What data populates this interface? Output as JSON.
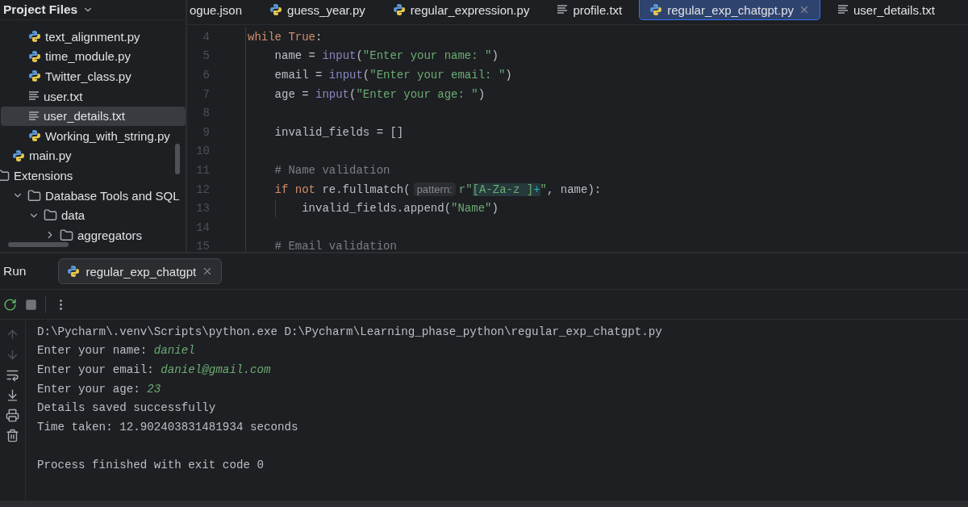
{
  "sidebar": {
    "title": "Project Files",
    "tree": [
      {
        "children": [
          {
            "children": [
              {
                "label": "text_alignment.py",
                "kind": "python",
                "selected": false
              },
              {
                "label": "time_module.py",
                "kind": "python",
                "selected": false
              },
              {
                "label": "Twitter_class.py",
                "kind": "python",
                "selected": false
              },
              {
                "label": "user.txt",
                "kind": "text",
                "selected": false
              },
              {
                "label": "user_details.txt",
                "kind": "text",
                "selected": true
              },
              {
                "label": "Working_with_string.py",
                "kind": "python",
                "selected": false
              }
            ]
          },
          {
            "label": "main.py",
            "kind": "python",
            "selected": false
          }
        ]
      },
      {
        "label": "Extensions",
        "kind": "folder",
        "selected": false,
        "children": [
          {
            "label": "Database Tools and SQL",
            "kind": "folder",
            "selected": false,
            "expanded": true,
            "children": [
              {
                "label": "data",
                "kind": "folder",
                "selected": false,
                "expanded": true,
                "children": [
                  {
                    "label": "aggregators",
                    "kind": "folder",
                    "selected": false,
                    "expanded": false
                  }
                ]
              }
            ]
          }
        ]
      }
    ]
  },
  "editor": {
    "tabs": [
      {
        "label": "ogue.json",
        "kind": "json",
        "selected": false,
        "closable": false
      },
      {
        "label": "guess_year.py",
        "kind": "python",
        "selected": false,
        "closable": false
      },
      {
        "label": "regular_expression.py",
        "kind": "python",
        "selected": false,
        "closable": false
      },
      {
        "label": "profile.txt",
        "kind": "text",
        "selected": false,
        "closable": false
      },
      {
        "label": "regular_exp_chatgpt.py",
        "kind": "python",
        "selected": true,
        "closable": true
      },
      {
        "label": "user_details.txt",
        "kind": "text",
        "selected": false,
        "closable": false
      }
    ],
    "lines": [
      {
        "number": "4",
        "tokens": [
          {
            "kind": "keyword",
            "text": "while True"
          },
          {
            "kind": "plain",
            "text": ":"
          }
        ]
      },
      {
        "number": "5",
        "tokens": [
          {
            "kind": "plain",
            "text": "    name = "
          },
          {
            "kind": "builtin",
            "text": "input"
          },
          {
            "kind": "plain",
            "text": "("
          },
          {
            "kind": "string",
            "text": "\"Enter your name: \""
          },
          {
            "kind": "plain",
            "text": ")"
          }
        ]
      },
      {
        "number": "6",
        "tokens": [
          {
            "kind": "plain",
            "text": "    email = "
          },
          {
            "kind": "builtin",
            "text": "input"
          },
          {
            "kind": "plain",
            "text": "("
          },
          {
            "kind": "string",
            "text": "\"Enter your email: \""
          },
          {
            "kind": "plain",
            "text": ")"
          }
        ]
      },
      {
        "number": "7",
        "tokens": [
          {
            "kind": "plain",
            "text": "    age = "
          },
          {
            "kind": "builtin",
            "text": "input"
          },
          {
            "kind": "plain",
            "text": "("
          },
          {
            "kind": "string",
            "text": "\"Enter your age: \""
          },
          {
            "kind": "plain",
            "text": ")"
          }
        ]
      },
      {
        "number": "8"
      },
      {
        "number": "9",
        "tokens": [
          {
            "kind": "plain",
            "text": "    invalid_fields = []"
          }
        ]
      },
      {
        "number": "10"
      },
      {
        "number": "11",
        "tokens": [
          {
            "kind": "comment",
            "text": "    # Name validation"
          }
        ]
      },
      {
        "number": "12",
        "tokens": [
          {
            "kind": "keyword",
            "text": "    if not"
          },
          {
            "kind": "plain",
            "text": " re.fullmatch("
          },
          {
            "kind": "hint",
            "text": "pattern:"
          },
          {
            "kind": "string",
            "text": "r\""
          },
          {
            "kind": "regex",
            "text": "[A-Za-z ]"
          },
          {
            "kind": "regex_op",
            "text": "+"
          },
          {
            "kind": "string",
            "text": "\""
          },
          {
            "kind": "plain",
            "text": ", name):"
          }
        ]
      },
      {
        "number": "13",
        "indent_guide": true,
        "tokens": [
          {
            "kind": "plain",
            "text": "        invalid_fields.append("
          },
          {
            "kind": "string",
            "text": "\"Name\""
          },
          {
            "kind": "plain",
            "text": ")"
          }
        ]
      },
      {
        "number": "14"
      },
      {
        "number": "15",
        "tokens": [
          {
            "kind": "comment",
            "text": "    # Email validation"
          }
        ]
      }
    ]
  },
  "run_panel": {
    "title": "Run",
    "tabs": [
      {
        "label": "regular_exp_chatgpt",
        "kind": "python",
        "selected": true,
        "closable": true
      }
    ],
    "toolbar": [
      {
        "kind": "rerun",
        "disabled": false
      },
      {
        "kind": "stop",
        "disabled": true
      },
      {
        "kind": "divider"
      },
      {
        "kind": "more"
      }
    ],
    "gutter": [
      {
        "kind": "up",
        "disabled": true
      },
      {
        "kind": "down",
        "disabled": true
      },
      {
        "kind": "wrap",
        "disabled": false
      },
      {
        "kind": "scroll_end",
        "disabled": false
      },
      {
        "kind": "print",
        "disabled": false
      },
      {
        "kind": "clear",
        "disabled": false
      }
    ],
    "console": [
      {
        "segments": [
          {
            "kind": "output",
            "text": "D:\\Pycharm\\.venv\\Scripts\\python.exe D:\\Pycharm\\Learning_phase_python\\regular_exp_chatgpt.py"
          }
        ]
      },
      {
        "segments": [
          {
            "kind": "output",
            "text": "Enter your name: "
          },
          {
            "kind": "input",
            "text": "daniel"
          }
        ]
      },
      {
        "segments": [
          {
            "kind": "output",
            "text": "Enter your email: "
          },
          {
            "kind": "input",
            "text": "daniel@gmail.com"
          }
        ]
      },
      {
        "segments": [
          {
            "kind": "output",
            "text": "Enter your age: "
          },
          {
            "kind": "input",
            "text": "23"
          }
        ]
      },
      {
        "segments": [
          {
            "kind": "output",
            "text": "Details saved successfully"
          }
        ]
      },
      {
        "segments": [
          {
            "kind": "output",
            "text": "Time taken: 12.902403831481934 seconds"
          }
        ]
      },
      {
        "blank_before": true,
        "segments": [
          {
            "kind": "output",
            "text": "Process finished with exit code 0"
          }
        ]
      }
    ]
  }
}
